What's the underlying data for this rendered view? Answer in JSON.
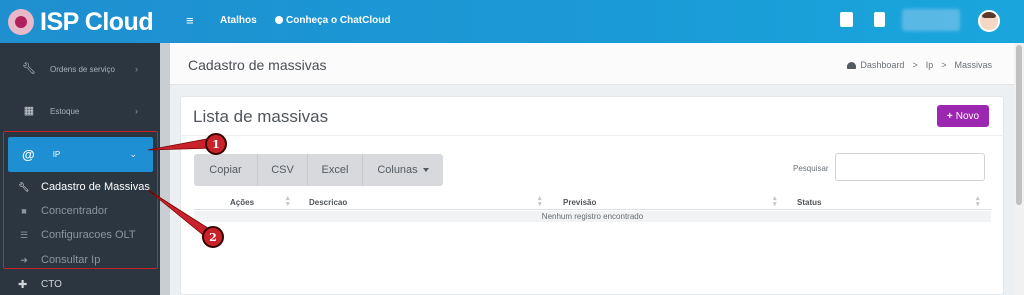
{
  "topbar": {
    "logo_text": "ISP Cloud",
    "menu_icon": "hamburger-icon",
    "nav": {
      "atalhos": "Atalhos",
      "chatcloud": "Conheça o ChatCloud"
    },
    "icons": [
      "note-icon",
      "building-icon"
    ],
    "avatar": "avatar"
  },
  "sidebar": {
    "items": [
      {
        "label": "Ordens de serviço",
        "icon": "wrench-icon"
      },
      {
        "label": "Estoque",
        "icon": "box-icon"
      }
    ],
    "active": {
      "label": "IP",
      "icon": "at-sign-icon"
    },
    "submenu": [
      {
        "label": "Cadastro de Massivas",
        "icon": "wrench-icon"
      },
      {
        "label": "Concentrador",
        "icon": "lock-icon"
      },
      {
        "label": "Configuracoes OLT",
        "icon": "list-icon"
      },
      {
        "label": "Consultar Ip",
        "icon": "arrow-right-icon"
      }
    ],
    "cto": {
      "label": "CTO",
      "icon": "plus-icon"
    }
  },
  "header": {
    "title": "Cadastro de massivas",
    "breadcrumb": [
      "Dashboard",
      "Ip",
      "Massivas"
    ],
    "sep": ">"
  },
  "card": {
    "title": "Lista de massivas",
    "new_button": "Novo",
    "toolbar": [
      "Copiar",
      "CSV",
      "Excel",
      "Colunas"
    ],
    "search_label": "Pesquisar",
    "search_value": "",
    "columns": [
      "Ações",
      "Descricao",
      "Previsão",
      "Status"
    ],
    "empty_message": "Nenhum registro encontrado"
  },
  "annotations": [
    "1",
    "2"
  ],
  "colors": {
    "topbar": "#1a9ad6",
    "sidebar": "#2b3640",
    "active": "#1e8fd3",
    "new_button": "#9c27b0",
    "annotation": "#c8222a"
  }
}
